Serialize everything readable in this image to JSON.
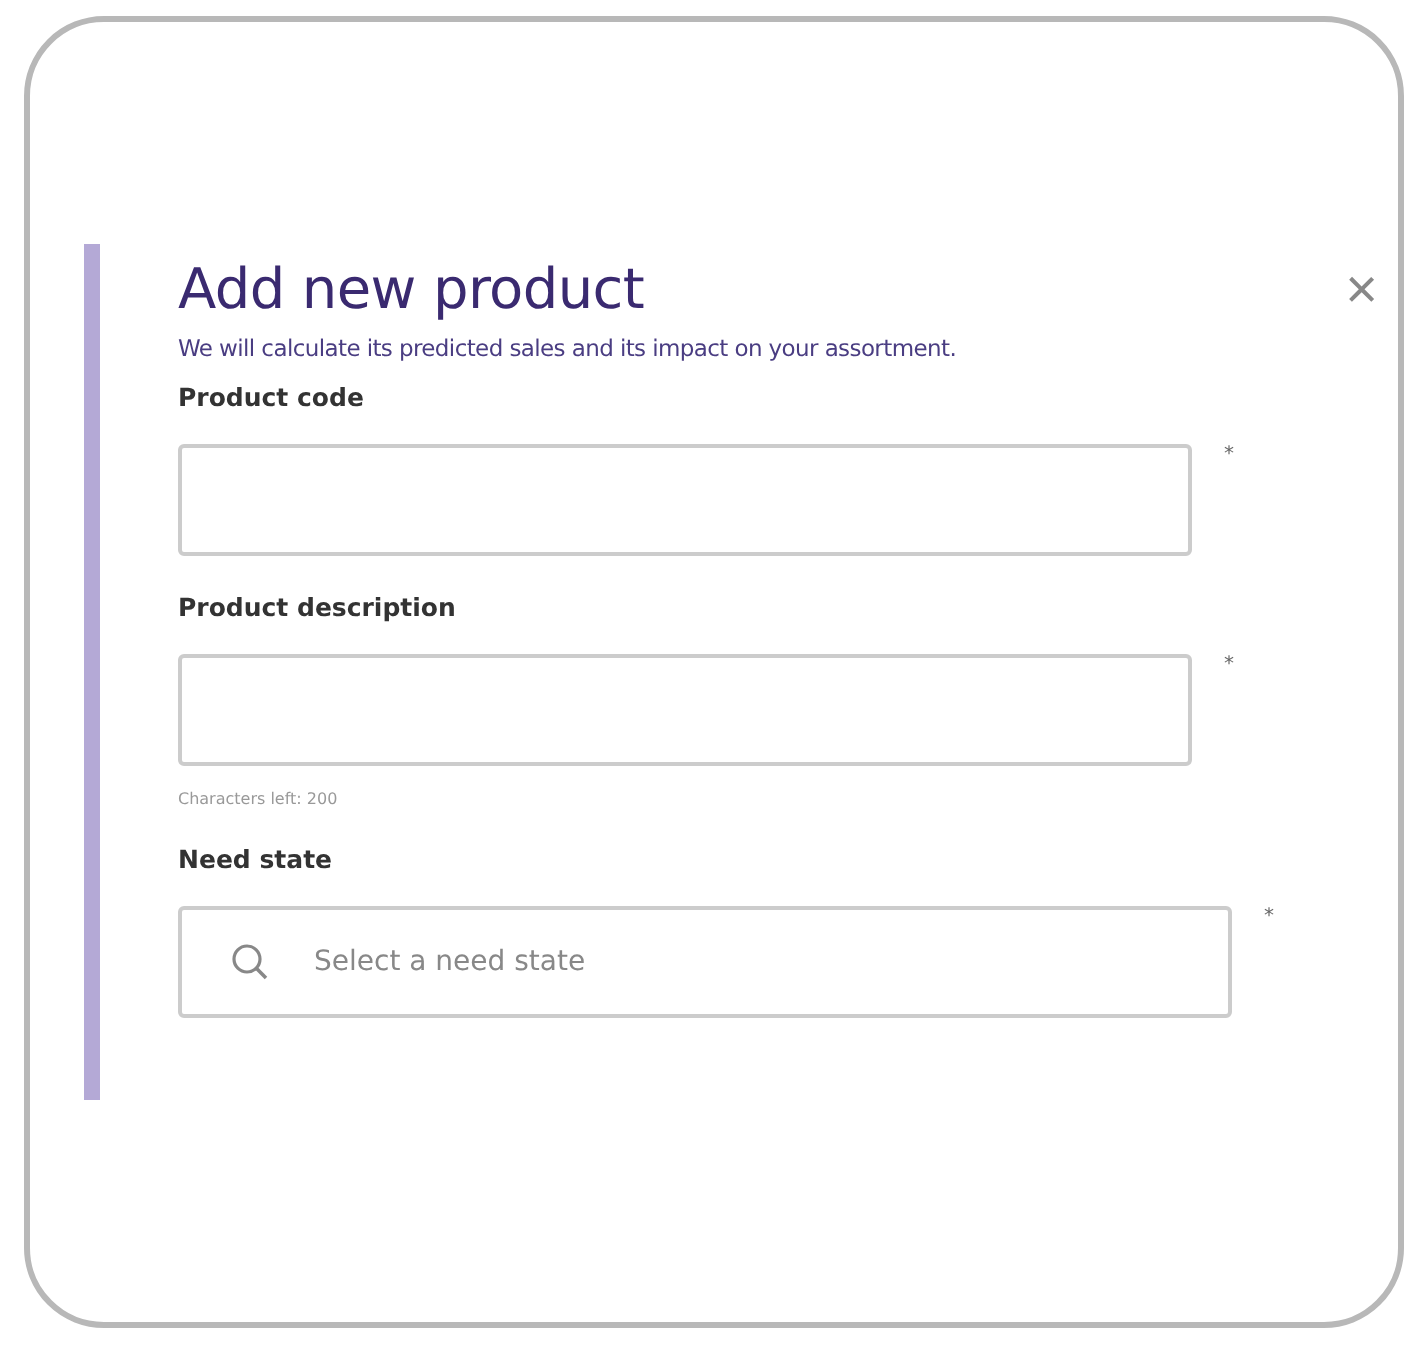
{
  "dialog": {
    "title": "Add new product",
    "close": "×",
    "subtitle": "We will calculate its predicted sales and its impact on your assortment.",
    "fields": [
      {
        "kind": "text",
        "label": "Product code",
        "required_mark": "*"
      },
      {
        "kind": "text",
        "label": "Product description",
        "required_mark": "*",
        "hint": "Characters left: 200"
      },
      {
        "kind": "search",
        "label": "Need state",
        "required_mark": "*",
        "placeholder": "Select a need state"
      }
    ]
  }
}
